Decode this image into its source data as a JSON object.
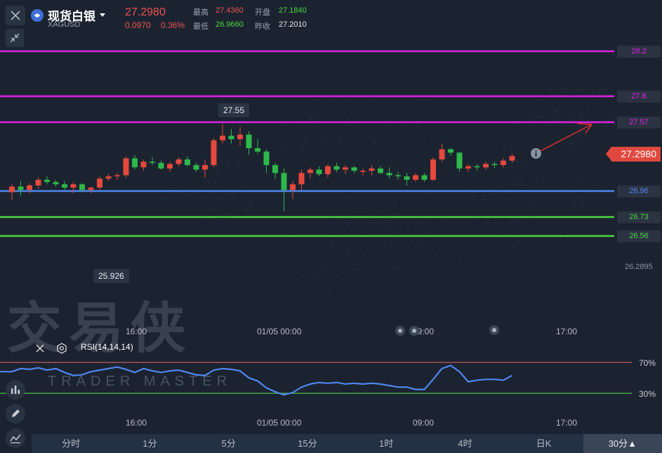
{
  "header": {
    "title": "现货白银",
    "code": "XAGUSD",
    "price": "27.2980",
    "change": "0.0970",
    "change_pct": "0.36%",
    "high_label": "最高",
    "high": "27.4360",
    "open_label": "开盘",
    "open": "27.1840",
    "low_label": "最低",
    "low": "26.9660",
    "prev_label": "昨收",
    "prev": "27.2010"
  },
  "levels": [
    {
      "name": "28.2",
      "value": 28.2,
      "color": "#e020e8"
    },
    {
      "name": "27.8",
      "value": 27.8,
      "color": "#e020e8"
    },
    {
      "name": "27.57",
      "value": 27.57,
      "color": "#e020e8"
    },
    {
      "name": "26.96",
      "value": 26.96,
      "color": "#4f87f0"
    },
    {
      "name": "26.73",
      "value": 26.73,
      "color": "#4cd940"
    },
    {
      "name": "26.56",
      "value": 26.56,
      "color": "#4cd940"
    }
  ],
  "price_labels": {
    "current": "27.2980",
    "axis_partial": "26.2895",
    "high_tip": "27.55",
    "low_tip": "25.926"
  },
  "time_axis": [
    "16:00",
    "01/05 00:00",
    "09:00",
    "17:00"
  ],
  "rsi": {
    "label": "RSI(14,14,14)",
    "upper": "70%",
    "lower": "30%",
    "color": "#4f87f0",
    "upper_color": "#c45a5a",
    "lower_color": "#4cc24c"
  },
  "watermark": {
    "cn": "交易侠",
    "en": "TRADER MASTER"
  },
  "tabs": [
    "分时",
    "1分",
    "5分",
    "15分",
    "1时",
    "4时",
    "日K",
    "30分▲"
  ],
  "selected_tab": "30分▲",
  "chart_data": {
    "type": "candlestick",
    "series": [
      {
        "name": "price",
        "ohlc": [
          [
            26.95,
            27.02,
            26.88,
            27.0
          ],
          [
            27.0,
            27.05,
            26.92,
            26.97
          ],
          [
            26.97,
            27.03,
            26.94,
            27.01
          ],
          [
            27.01,
            27.08,
            26.98,
            27.06
          ],
          [
            27.06,
            27.09,
            27.02,
            27.04
          ],
          [
            27.04,
            27.06,
            27.0,
            27.02
          ],
          [
            27.02,
            27.05,
            26.97,
            26.99
          ],
          [
            26.99,
            27.04,
            26.94,
            27.02
          ],
          [
            27.02,
            27.03,
            26.95,
            26.97
          ],
          [
            26.97,
            27.0,
            26.94,
            26.99
          ],
          [
            26.99,
            27.09,
            26.97,
            27.07
          ],
          [
            27.07,
            27.11,
            27.05,
            27.09
          ],
          [
            27.09,
            27.12,
            27.06,
            27.1
          ],
          [
            27.1,
            27.27,
            27.08,
            27.25
          ],
          [
            27.25,
            27.28,
            27.15,
            27.17
          ],
          [
            27.17,
            27.24,
            27.14,
            27.22
          ],
          [
            27.22,
            27.26,
            27.19,
            27.21
          ],
          [
            27.21,
            27.23,
            27.15,
            27.16
          ],
          [
            27.16,
            27.22,
            27.13,
            27.2
          ],
          [
            27.2,
            27.26,
            27.18,
            27.24
          ],
          [
            27.24,
            27.27,
            27.18,
            27.19
          ],
          [
            27.19,
            27.21,
            27.13,
            27.15
          ],
          [
            27.15,
            27.24,
            27.08,
            27.19
          ],
          [
            27.19,
            27.43,
            27.17,
            27.41
          ],
          [
            27.41,
            27.55,
            27.38,
            27.45
          ],
          [
            27.45,
            27.51,
            27.38,
            27.42
          ],
          [
            27.42,
            27.53,
            27.36,
            27.46
          ],
          [
            27.46,
            27.49,
            27.28,
            27.34
          ],
          [
            27.34,
            27.42,
            27.29,
            27.31
          ],
          [
            27.31,
            27.33,
            27.12,
            27.19
          ],
          [
            27.19,
            27.21,
            27.07,
            27.12
          ],
          [
            27.12,
            27.16,
            26.78,
            26.97
          ],
          [
            26.97,
            27.05,
            26.89,
            27.02
          ],
          [
            27.02,
            27.15,
            26.97,
            27.12
          ],
          [
            27.12,
            27.17,
            27.07,
            27.15
          ],
          [
            27.15,
            27.18,
            27.09,
            27.11
          ],
          [
            27.11,
            27.2,
            27.08,
            27.18
          ],
          [
            27.18,
            27.21,
            27.13,
            27.15
          ],
          [
            27.15,
            27.19,
            27.11,
            27.17
          ],
          [
            27.17,
            27.18,
            27.12,
            27.14
          ],
          [
            27.14,
            27.16,
            27.1,
            27.14
          ],
          [
            27.14,
            27.19,
            27.1,
            27.16
          ],
          [
            27.16,
            27.18,
            27.11,
            27.12
          ],
          [
            27.12,
            27.17,
            27.07,
            27.1
          ],
          [
            27.1,
            27.13,
            27.06,
            27.09
          ],
          [
            27.09,
            27.12,
            27.01,
            27.06
          ],
          [
            27.06,
            27.12,
            27.04,
            27.1
          ],
          [
            27.1,
            27.12,
            27.04,
            27.06
          ],
          [
            27.06,
            27.26,
            27.05,
            27.24
          ],
          [
            27.24,
            27.38,
            27.22,
            27.33
          ],
          [
            27.33,
            27.34,
            27.27,
            27.3
          ],
          [
            27.3,
            27.31,
            27.13,
            27.16
          ],
          [
            27.16,
            27.19,
            27.13,
            27.18
          ],
          [
            27.18,
            27.2,
            27.14,
            27.17
          ],
          [
            27.17,
            27.22,
            27.15,
            27.2
          ],
          [
            27.2,
            27.22,
            27.16,
            27.19
          ],
          [
            27.19,
            27.25,
            27.17,
            27.23
          ],
          [
            27.23,
            27.29,
            27.21,
            27.27
          ]
        ]
      },
      {
        "name": "rsi",
        "values": [
          58,
          62,
          61,
          63,
          60,
          62,
          57,
          53,
          54,
          58,
          60,
          62,
          64,
          61,
          57,
          62,
          59,
          57,
          59,
          60,
          57,
          54,
          53,
          60,
          62,
          61,
          59,
          50,
          46,
          37,
          32,
          28,
          31,
          38,
          42,
          44,
          43,
          44,
          42,
          43,
          42,
          43,
          42,
          40,
          38,
          38,
          35,
          35,
          48,
          62,
          66,
          58,
          45,
          47,
          48,
          48,
          47,
          53
        ],
        "ylim": [
          0,
          100
        ]
      }
    ],
    "price_ylim": [
      25.9,
      28.3
    ]
  }
}
